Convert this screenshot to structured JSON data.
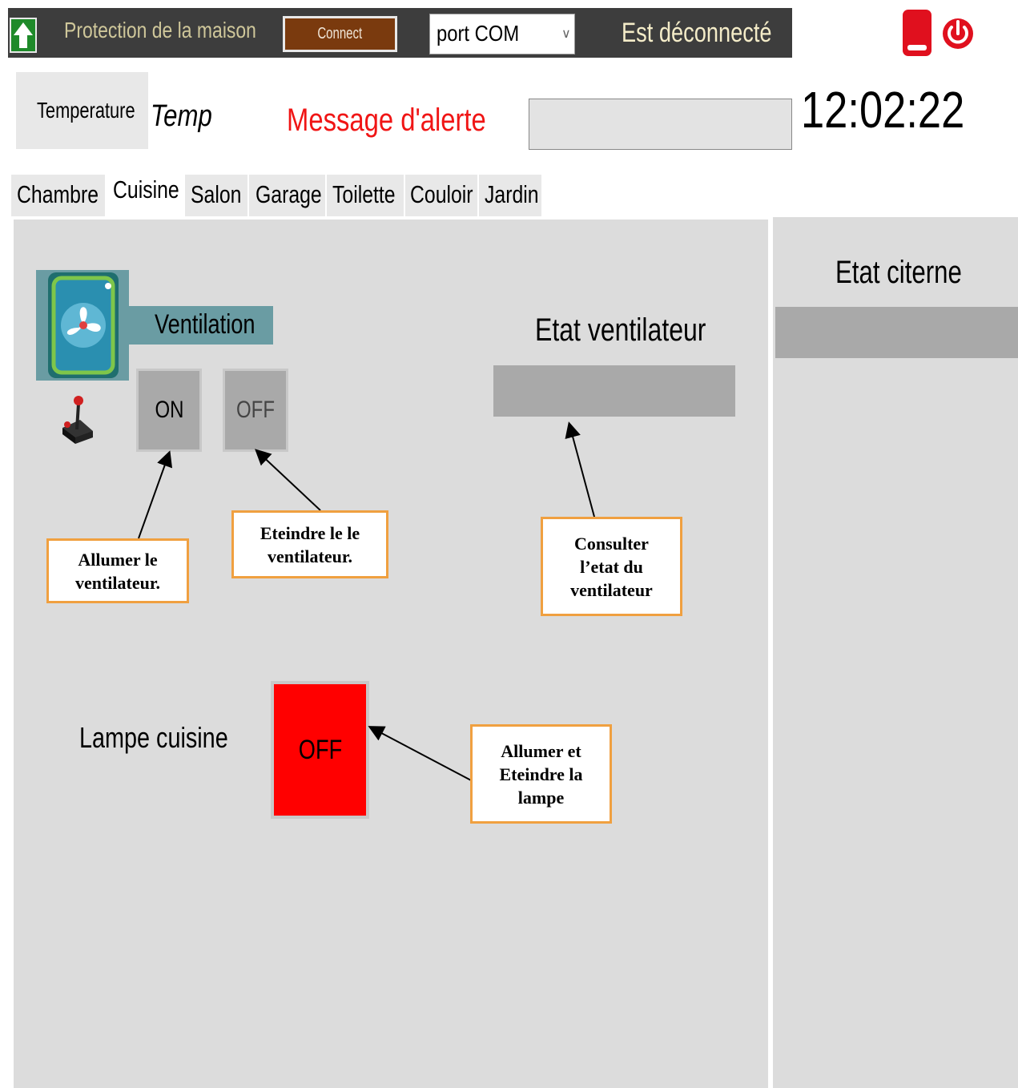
{
  "header": {
    "title": "Protection de la maison",
    "connect_label": "Connect",
    "port_value": "port COM",
    "connection_status": "Est déconnecté",
    "exit_icon": "exit-icon",
    "power_icon": "power-icon",
    "home_icon": "home-up-arrow-icon"
  },
  "info": {
    "temperature_label": "Temperature",
    "temperature_value": "Temp",
    "alert_label": "Message d'alerte",
    "alert_value": "",
    "clock": "12:02:22"
  },
  "tabs": [
    {
      "label": "Chambre",
      "active": false
    },
    {
      "label": "Cuisine",
      "active": true
    },
    {
      "label": "Salon",
      "active": false
    },
    {
      "label": "Garage",
      "active": false
    },
    {
      "label": "Toilette",
      "active": false
    },
    {
      "label": "Couloir",
      "active": false
    },
    {
      "label": "Jardin",
      "active": false
    }
  ],
  "kitchen": {
    "ventilation_label": "Ventilation",
    "fan_icon": "fan-icon",
    "joystick_icon": "joystick-icon",
    "on_label": "ON",
    "off_label": "OFF",
    "fan_state_label": "Etat ventilateur",
    "fan_state_value": "",
    "lamp_label": "Lampe cuisine",
    "lamp_button_label": "OFF",
    "lamp_color": "#ff0000"
  },
  "side": {
    "tank_label": "Etat citerne",
    "tank_value": ""
  },
  "annotations": {
    "on_note": "Allumer le ventilateur.",
    "off_note": "Eteindre le le ventilateur.",
    "state_note": "Consulter l’etat du ventilateur",
    "lamp_note": "Allumer et Eteindre la lampe"
  }
}
